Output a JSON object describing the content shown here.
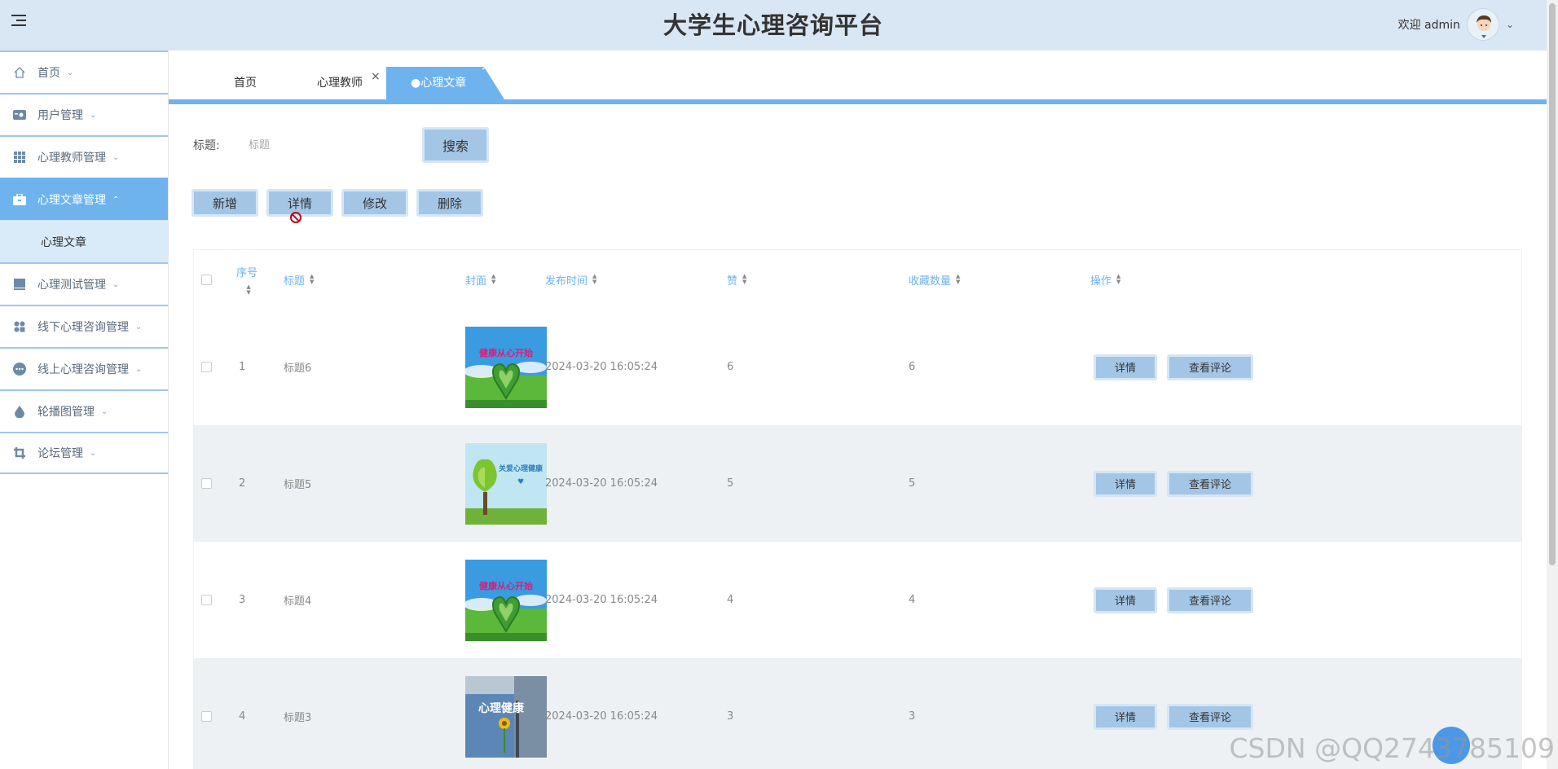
{
  "header": {
    "title": "大学生心理咨询平台",
    "welcome": "欢迎 admin"
  },
  "sidebar": {
    "items": [
      {
        "label": "首页",
        "icon": "home-icon"
      },
      {
        "label": "用户管理",
        "icon": "user-card-icon"
      },
      {
        "label": "心理教师管理",
        "icon": "grid-icon"
      },
      {
        "label": "心理文章管理",
        "icon": "briefcase-icon",
        "active": true
      },
      {
        "label": "心理测试管理",
        "icon": "monitor-icon"
      },
      {
        "label": "线下心理咨询管理",
        "icon": "apps-icon"
      },
      {
        "label": "线上心理咨询管理",
        "icon": "chat-icon"
      },
      {
        "label": "轮播图管理",
        "icon": "drop-icon"
      },
      {
        "label": "论坛管理",
        "icon": "crop-icon"
      }
    ],
    "sub_item": "心理文章"
  },
  "tabs": {
    "home": "首页",
    "teacher": "心理教师",
    "article": "●心理文章",
    "close": "×"
  },
  "search": {
    "label": "标题:",
    "placeholder": "标题",
    "button": "搜索"
  },
  "actions": {
    "add": "新增",
    "detail": "详情",
    "edit": "修改",
    "delete": "删除"
  },
  "table": {
    "headers": [
      "序号",
      "标题",
      "封面",
      "发布时间",
      "赞",
      "收藏数量",
      "操作"
    ],
    "rows": [
      {
        "no": "1",
        "title": "标题6",
        "cover": "健康从心开始",
        "time": "2024-03-20 16:05:24",
        "likes": "6",
        "favorites": "6"
      },
      {
        "no": "2",
        "title": "标题5",
        "cover": "关爱心理健康",
        "time": "2024-03-20 16:05:24",
        "likes": "5",
        "favorites": "5"
      },
      {
        "no": "3",
        "title": "标题4",
        "cover": "健康从心开始",
        "time": "2024-03-20 16:05:24",
        "likes": "4",
        "favorites": "4"
      },
      {
        "no": "4",
        "title": "标题3",
        "cover": "心理健康",
        "time": "2024-03-20 16:05:24",
        "likes": "3",
        "favorites": "3"
      }
    ],
    "row_detail": "详情",
    "row_comment": "查看评论"
  },
  "watermark": "CSDN @QQ2743785109",
  "colors": {
    "header_bg": "#d9e6f3",
    "accent": "#6eb3ee",
    "button_bg": "#a4c6e6"
  }
}
